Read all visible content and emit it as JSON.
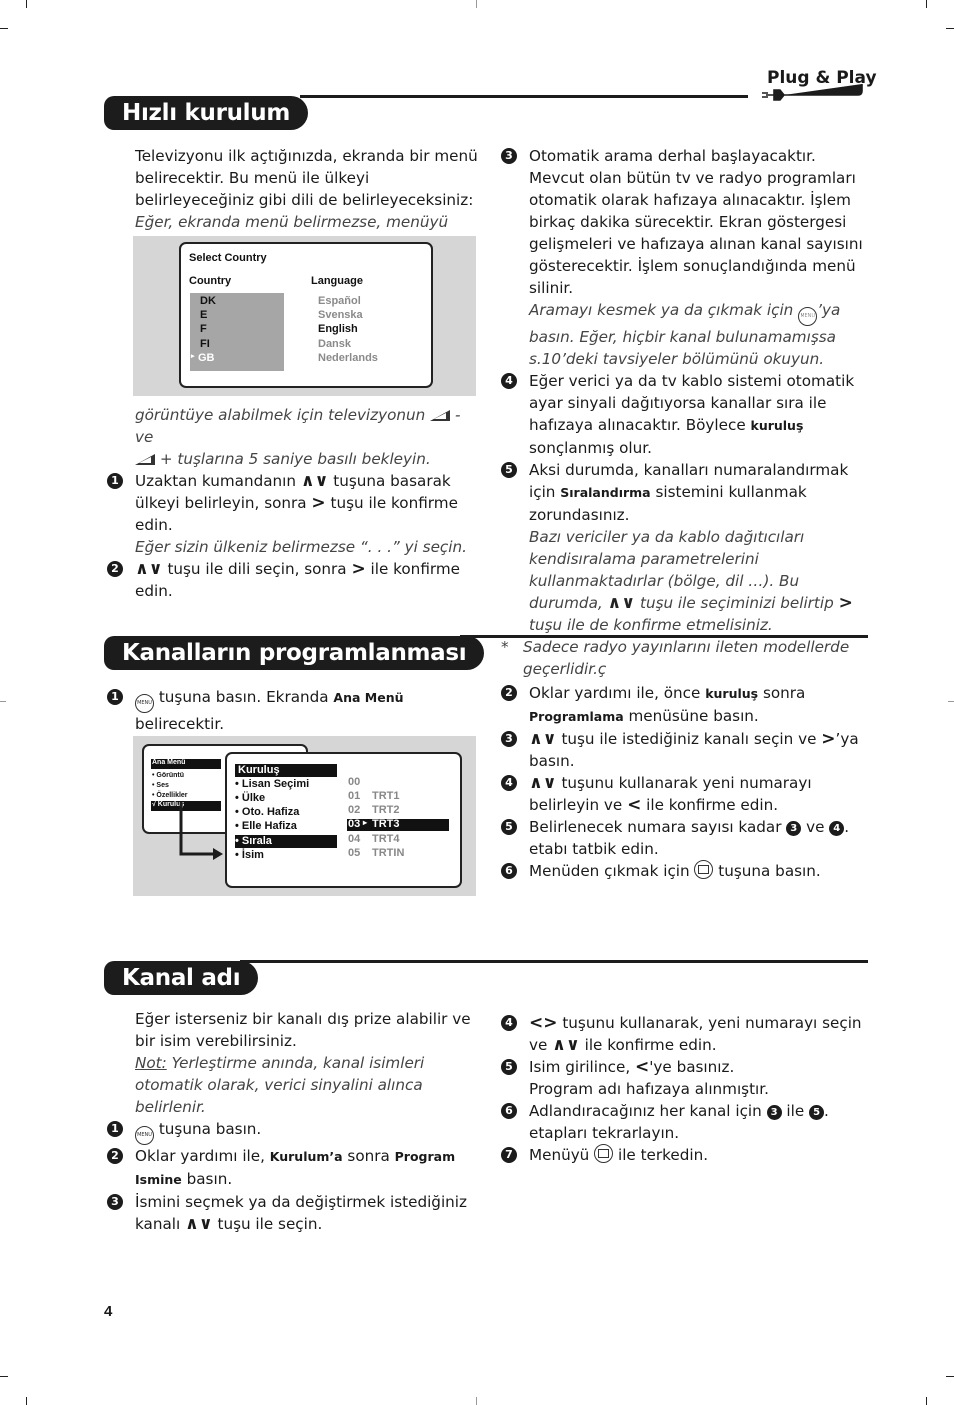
{
  "brand_tag": "Plug & Play",
  "page_number": "4",
  "sections": {
    "quick_setup": {
      "title": "Hızlı kurulum",
      "intro": "Televizyonu ilk açtığınızda, ekranda bir menü belirecektir. Bu menü ile ülkeyi belirleyeceğiniz gibi dili de belirleyeceksiniz:",
      "note_before_screen": "Eğer, ekranda menü belirmezse, menüyü",
      "note_after_screen_a": "görüntüye alabilmek için televizyonun",
      "note_after_screen_b": "- ve",
      "note_after_screen_c": "+ tuşlarına 5 saniye basılı bekleyin.",
      "screen": {
        "title": "Select Country",
        "country_header": "Country",
        "language_header": "Language",
        "countries": [
          "DK",
          "E",
          "F",
          "FI",
          "GB"
        ],
        "selected_country": "GB",
        "languages": [
          "Español",
          "Svenska",
          "English",
          "Dansk",
          "Nederlands"
        ],
        "selected_language": "English"
      },
      "steps": [
        {
          "n": "1",
          "a": "Uzaktan kumandanın",
          "b": "tuşuna basarak ülkeyi belirleyin, sonra",
          "c": "tuşu ile konfirme edin.",
          "note": "Eğer sizin ülkeniz belirmezse “. . .” yi seçin."
        },
        {
          "n": "2",
          "b": "tuşu ile dili seçin, sonra",
          "c": "ile konfirme edin."
        },
        {
          "n": "3",
          "text": "Otomatik arama derhal başlayacaktır. Mevcut olan bütün tv ve radyo programları otomatik olarak hafızaya alınacaktır. İşlem birkaç dakika sürecektir. Ekran göstergesi gelişmeleri ve hafızaya alınan kanal sayısını gösterecektir. İşlem sonuçlandığında menü silinir.",
          "note_a": "Aramayı kesmek ya da çıkmak için",
          "note_b": "’ya basın. Eğer, hiçbir kanal bulunamamışsa s.10’deki tavsiyeler bölümünü okuyun."
        },
        {
          "n": "4",
          "a": "Eğer verici ya da tv kablo sistemi otomatik ayar sinyali dağıtıyorsa kanallar sıra ile hafızaya alınacaktır. Böylece",
          "b": "kuruluş",
          "c": "sonçlanmış olur."
        },
        {
          "n": "5",
          "a": "Aksi durumda, kanalları numaralandırmak için",
          "b": "Sıralandırma",
          "c": "sistemini kullanmak zorundasınız.",
          "note_a": "Bazı vericiler ya da kablo dağıtıcıları kendisıralama parametrelerini kullanmaktadırlar (bölge, dil …). Bu durumda,",
          "note_b": "tuşu ile seçiminizi belirtip",
          "note_c": "tuşu ile de konfirme etmelisiniz."
        }
      ],
      "footnote_mark": "*",
      "footnote": "Sadece radyo yayınlarını ileten modellerde geçerlidir.ç"
    },
    "channel_programming": {
      "title": "Kanalların programlanması",
      "steps": [
        {
          "n": "1",
          "a": "tuşuna basın. Ekranda",
          "b": "Ana Menü",
          "c": "belirecektir."
        },
        {
          "n": "2",
          "a": "Oklar yardımı ile, önce",
          "b": "kuruluş",
          "c": "sonra",
          "d": "Programlama",
          "e": "menüsüne basın."
        },
        {
          "n": "3",
          "a": "tuşu ile istediğiniz kanalı seçin ve",
          "b": "’ya basın."
        },
        {
          "n": "4",
          "a": "tuşunu kullanarak yeni numarayı belirleyin ve",
          "b": "ile konfirme edin."
        },
        {
          "n": "5",
          "a": "Belirlenecek numara sayısı kadar",
          "b": "ve",
          "c": ". etabı tatbik edin."
        },
        {
          "n": "6",
          "a": "Menüden çıkmak için",
          "b": "tuşuna basın."
        }
      ],
      "screen": {
        "main_menu_title": "Ana Menü",
        "main_menu_items": [
          "• Görüntü",
          "• Ses",
          "• Özellikler",
          "√ Kuruluş"
        ],
        "selected_main": "√ Kuruluş",
        "submenu_title": "Kuruluş",
        "submenu_items": [
          "• Lisan Seçimi",
          "• Ülke",
          "• Oto. Hafiza",
          "• Elle Hafiza",
          "• Sırala",
          "• İsim"
        ],
        "selected_submenu": "• Sırala",
        "channels": [
          {
            "num": "00",
            "name": ""
          },
          {
            "num": "01",
            "name": "TRT1"
          },
          {
            "num": "02",
            "name": "TRT2"
          },
          {
            "num": "03",
            "name": "TRT3",
            "selected": true
          },
          {
            "num": "04",
            "name": "TRT4"
          },
          {
            "num": "05",
            "name": "TRTIN"
          }
        ],
        "selected_marker": "▸"
      }
    },
    "channel_name": {
      "title": "Kanal adı",
      "intro": "Eğer isterseniz bir kanalı dış prize alabilir ve bir isim verebilirsiniz.",
      "note_label": "Not:",
      "note": "Yerleştirme anında, kanal isimleri otomatik olarak, verici sinyalini alınca belirlenir.",
      "steps": [
        {
          "n": "1",
          "a": "tuşuna basın."
        },
        {
          "n": "2",
          "a": "Oklar yardımı ile,",
          "b": "Kurulum’a",
          "c": "sonra",
          "d": "Program Ismine",
          "e": "basın."
        },
        {
          "n": "3",
          "a": "İsmini seçmek ya da değiştirmek istediğiniz kanalı",
          "b": "tuşu ile seçin."
        },
        {
          "n": "4",
          "a": "tuşunu kullanarak, yeni numarayı seçin ve",
          "b": "ile konfirme edin."
        },
        {
          "n": "5",
          "a": "Isim girilince,",
          "b": "'ye basınız.",
          "c": "Program adı hafızaya alınmıştır."
        },
        {
          "n": "6",
          "a": "Adlandıracağınız her kanal için",
          "b": "ile",
          "c": ". etapları tekrarlayın."
        },
        {
          "n": "7",
          "a": "Menüyü",
          "b": "ile terkedin."
        }
      ]
    }
  },
  "glyphs": {
    "up_down": "∧∨",
    "right": ">",
    "left": "<",
    "left_right": "<>",
    "menu_key": "MENU",
    "circled_3": "3",
    "circled_4": "4",
    "circled_5": "5"
  }
}
